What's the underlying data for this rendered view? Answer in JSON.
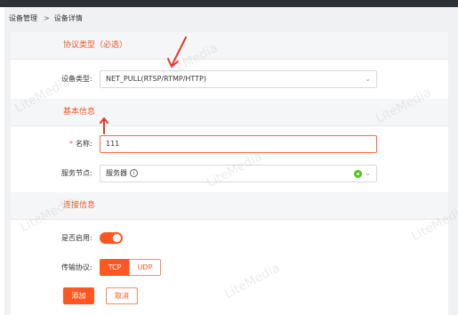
{
  "breadcrumb": {
    "parent": "设备管理",
    "separator": ">",
    "current": "设备详情"
  },
  "sections": {
    "protocol_type": {
      "title": "协议类型（必选）"
    },
    "basic_info": {
      "title": "基本信息"
    },
    "connection_info": {
      "title": "连接信息"
    }
  },
  "form": {
    "device_type": {
      "label": "设备类型:",
      "value": "NET_PULL(RTSP/RTMP/HTTP)"
    },
    "name": {
      "required_mark": "*",
      "label": "名称:",
      "value": "111"
    },
    "service_node": {
      "label": "服务节点:",
      "value": "服务器",
      "status_color": "#52c41a"
    },
    "enabled": {
      "label": "是否启用:",
      "on": true
    },
    "transport": {
      "label": "传输协议:",
      "options": [
        "TCP",
        "UDP"
      ],
      "selected": "TCP"
    }
  },
  "actions": {
    "add": "添加",
    "cancel": "取消"
  },
  "watermark": "LiteMedia",
  "colors": {
    "accent": "#ff5722",
    "section_title": "#e85a2c",
    "annotation_arrow": "#e8382b"
  }
}
